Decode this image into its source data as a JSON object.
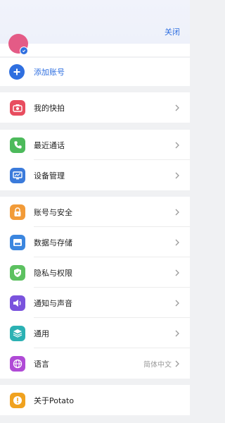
{
  "header": {
    "close_label": "关闭"
  },
  "account": {
    "add_account_label": "添加账号"
  },
  "groups": [
    {
      "items": [
        {
          "label": "我的快拍",
          "icon": "camera-icon",
          "color": "#e84d5f"
        }
      ]
    },
    {
      "items": [
        {
          "label": "最近通话",
          "icon": "phone-icon",
          "color": "#4cba5b"
        },
        {
          "label": "设备管理",
          "icon": "device-monitor-icon",
          "color": "#3b7bdb"
        }
      ]
    },
    {
      "items": [
        {
          "label": "账号与安全",
          "icon": "lock-icon",
          "color": "#f29b38"
        },
        {
          "label": "数据与存储",
          "icon": "storage-icon",
          "color": "#3b86df"
        },
        {
          "label": "隐私与权限",
          "icon": "shield-check-icon",
          "color": "#5cc160"
        },
        {
          "label": "通知与声音",
          "icon": "speaker-icon",
          "color": "#7a53dd"
        },
        {
          "label": "通用",
          "icon": "layers-icon",
          "color": "#2bb1b3"
        },
        {
          "label": "语言",
          "icon": "globe-icon",
          "color": "#b04ad6",
          "value": "简体中文"
        }
      ]
    },
    {
      "items": [
        {
          "label": "关于Potato",
          "icon": "info-exclamation-icon",
          "color": "#f0a21f"
        }
      ]
    }
  ],
  "colors": {
    "accent": "#2f6fe0",
    "background": "#f0f1f3"
  }
}
